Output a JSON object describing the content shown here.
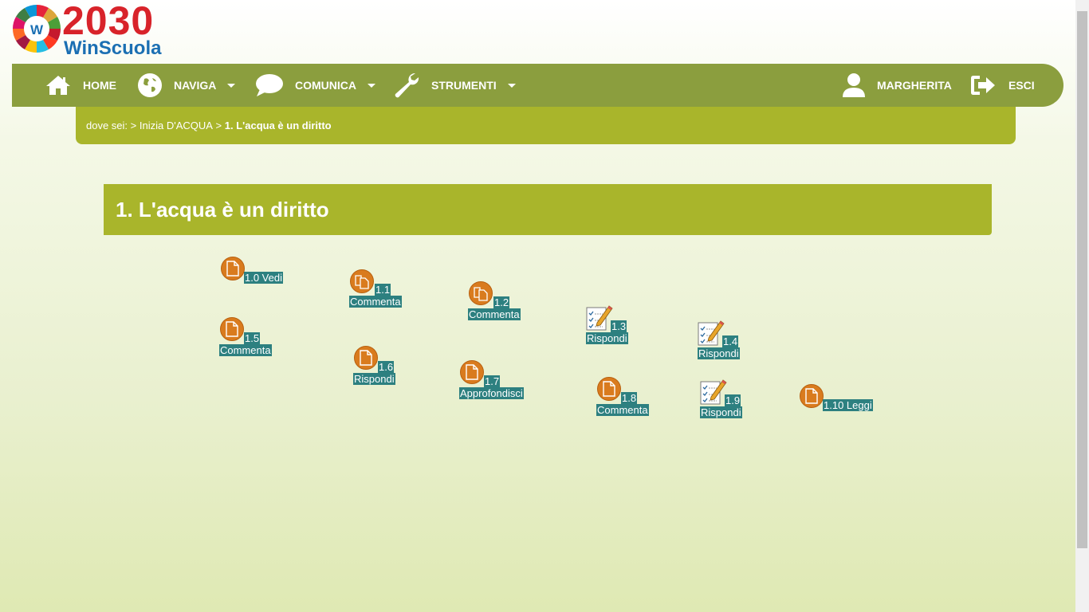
{
  "logo": {
    "year": "2030",
    "brand": "WinScuola",
    "ring_letter": "W"
  },
  "nav": {
    "home": "HOME",
    "naviga": "NAVIGA",
    "comunica": "COMUNICA",
    "strumenti": "STRUMENTI",
    "user": "MARGHERITA",
    "logout": "ESCI"
  },
  "breadcrumb": {
    "prefix": "dove sei:",
    "sep1": " > ",
    "parent": "Inizia D'ACQUA",
    "sep2": " > ",
    "current": "1. L'acqua è un diritto"
  },
  "page_title": "1. L'acqua è un diritto",
  "activities": [
    {
      "id": "1.0",
      "line1": "1.0 Vedi",
      "line2": "",
      "icon": "document-icon"
    },
    {
      "id": "1.1",
      "line1": "1.1",
      "line2": "Commenta",
      "icon": "documents-icon"
    },
    {
      "id": "1.2",
      "line1": "1.2",
      "line2": "Commenta",
      "icon": "documents-icon"
    },
    {
      "id": "1.3",
      "line1": "1.3",
      "line2": "Rispondi",
      "icon": "quiz-pencil-icon"
    },
    {
      "id": "1.4",
      "line1": "1.4",
      "line2": "Rispondi",
      "icon": "quiz-pencil-icon"
    },
    {
      "id": "1.5",
      "line1": "1.5",
      "line2": "Commenta",
      "icon": "document-icon"
    },
    {
      "id": "1.6",
      "line1": "1.6",
      "line2": "Rispondi",
      "icon": "document-icon"
    },
    {
      "id": "1.7",
      "line1": "1.7",
      "line2": "Approfondisci",
      "icon": "document-icon"
    },
    {
      "id": "1.8",
      "line1": "1.8",
      "line2": "Commenta",
      "icon": "document-icon"
    },
    {
      "id": "1.9",
      "line1": "1.9",
      "line2": "Rispondi",
      "icon": "quiz-pencil-icon"
    },
    {
      "id": "1.10",
      "line1": "1.10 Leggi",
      "line2": "",
      "icon": "document-icon"
    }
  ],
  "colors": {
    "nav_bg": "#8b9e3e",
    "header_bg": "#a9b52b",
    "label_bg": "#2d8080",
    "icon_orange": "#d97b1e"
  }
}
